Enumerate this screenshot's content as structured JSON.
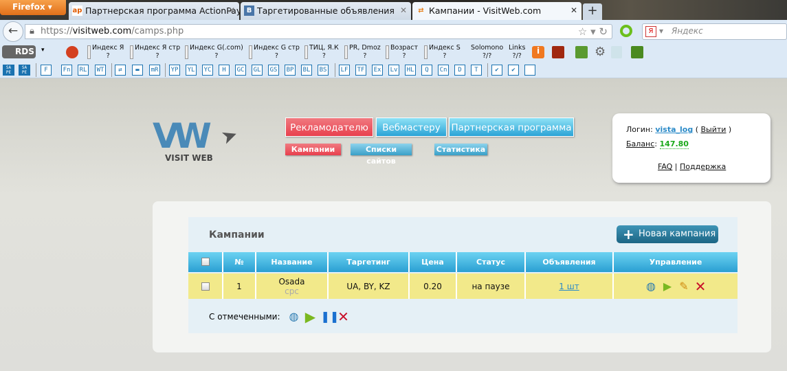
{
  "browser": {
    "menu_label": "Firefox",
    "tabs": [
      {
        "title": "Партнерская программа ActionPay....",
        "favicon": "ap"
      },
      {
        "title": "Таргетированные объявления",
        "favicon": "B"
      },
      {
        "title": "Кампании - VisitWeb.com",
        "favicon": "visitweb-arrows"
      }
    ],
    "url_prefix": "https://",
    "url_domain": "visitweb.com",
    "url_path": "/camps.php",
    "search_placeholder": "Яндекс"
  },
  "toolbar": {
    "rds_label": "RDS",
    "indicators": [
      {
        "label": "Индекс Я",
        "value": "?"
      },
      {
        "label": "Индекс Я стр",
        "value": "?"
      },
      {
        "label": "Индекс G(.com)",
        "value": "?"
      },
      {
        "label": "Индекс G стр",
        "value": "?"
      },
      {
        "label": "ТИЦ, Я.К",
        "value": "?"
      },
      {
        "label": "PR, Dmoz",
        "value": "?"
      },
      {
        "label": "Возраст",
        "value": "?"
      },
      {
        "label": "Индекс S",
        "value": "?"
      },
      {
        "label": "Solomono",
        "value": "?/?"
      },
      {
        "label": "Links",
        "value": "?/?"
      }
    ],
    "buttons": [
      "SA PE",
      "SA PE",
      "F",
      "Fn",
      "RL",
      "WT",
      "⇄",
      "▬",
      "mR",
      "YP",
      "YL",
      "YC",
      "H",
      "GC",
      "GL",
      "GS",
      "BP",
      "BL",
      "BS",
      "LF",
      "TF",
      "Ex",
      "Lv",
      "HL",
      "Q",
      "Cn",
      "D",
      "T",
      "✔",
      "✔",
      ""
    ]
  },
  "site": {
    "logo_text": "VISIT WEB",
    "main_nav": [
      "Рекламодателю",
      "Вебмастеру",
      "Партнерская программа"
    ],
    "sub_nav": [
      "Кампании",
      "Списки сайтов",
      "Статистика"
    ],
    "user": {
      "login_label": "Логин:",
      "login": "vista_log",
      "logout": "Выйти",
      "balance_label": "Баланс",
      "balance": "147.80",
      "faq": "FAQ",
      "support": "Поддержка"
    },
    "accent_red": "#e8404e",
    "accent_blue": "#2aa3d6"
  },
  "campaigns": {
    "title": "Кампании",
    "new_button": "Новая кампания",
    "columns": [
      "",
      "№",
      "Название",
      "Таргетинг",
      "Цена",
      "Статус",
      "Объявления",
      "Управление"
    ],
    "rows": [
      {
        "num": "1",
        "name": "Osada",
        "type": "cpc",
        "targeting": "UA, BY, KZ",
        "price": "0.20",
        "status": "на паузе",
        "ads": "1 шт",
        "actions": [
          "globe-car-icon",
          "play-icon",
          "edit-pencil-icon",
          "delete-x-icon"
        ]
      }
    ],
    "bulk_label": "С отмеченными:",
    "bulk_actions": [
      "globe-car-icon",
      "play-icon",
      "pause-icon",
      "delete-x-icon"
    ]
  }
}
